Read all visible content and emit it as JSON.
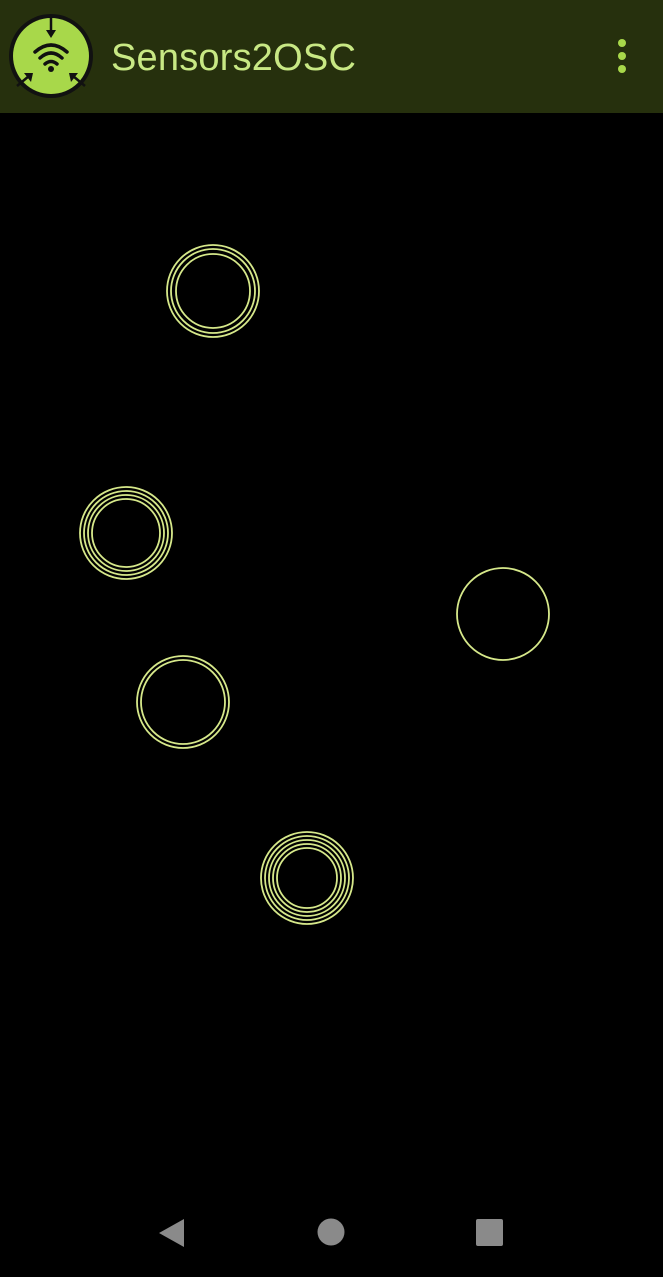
{
  "app_bar": {
    "title": "Sensors2OSC",
    "logo_icon": "sensors2osc-logo-icon",
    "overflow_icon": "more-vert-icon",
    "background_color": "#26300d",
    "accent_color": "#a8d84a",
    "title_color": "#c8e884"
  },
  "touch_area": {
    "background_color": "#000000",
    "ring_color": "#d6e88a",
    "touch_points": [
      {
        "rings": 3
      },
      {
        "rings": 4
      },
      {
        "rings": 1
      },
      {
        "rings": 2
      },
      {
        "rings": 5
      }
    ]
  },
  "nav_bar": {
    "back_icon": "back-triangle-icon",
    "home_icon": "home-circle-icon",
    "recents_icon": "recents-square-icon",
    "icon_color": "#8a8a8a"
  }
}
